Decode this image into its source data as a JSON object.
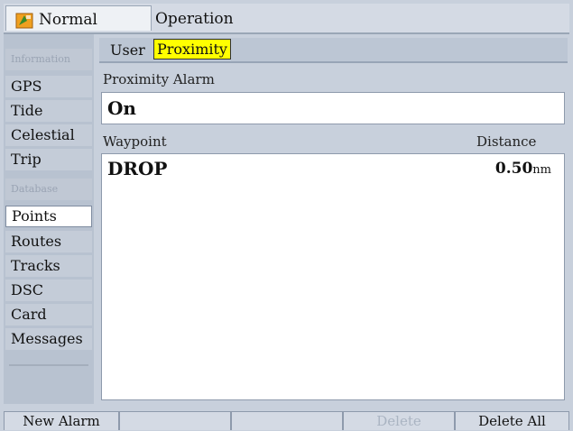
{
  "titlebar": {
    "app_name": "Normal",
    "page_title": "Operation",
    "icon": "vessel-flag-icon"
  },
  "sidebar": {
    "items": [
      {
        "label": "Information",
        "state": "disabled"
      },
      {
        "label": "GPS",
        "state": "normal"
      },
      {
        "label": "Tide",
        "state": "normal"
      },
      {
        "label": "Celestial",
        "state": "normal"
      },
      {
        "label": "Trip",
        "state": "normal"
      },
      {
        "label": "Database",
        "state": "disabled"
      },
      {
        "label": "Points",
        "state": "selected"
      },
      {
        "label": "Routes",
        "state": "normal"
      },
      {
        "label": "Tracks",
        "state": "normal"
      },
      {
        "label": "DSC",
        "state": "normal"
      },
      {
        "label": "Card",
        "state": "normal"
      },
      {
        "label": "Messages",
        "state": "normal"
      }
    ]
  },
  "subtabs": {
    "user": "User",
    "proximity": "Proximity"
  },
  "proximity_alarm": {
    "label": "Proximity Alarm",
    "value": "On"
  },
  "table": {
    "col_waypoint": "Waypoint",
    "col_distance": "Distance",
    "rows": [
      {
        "waypoint": "DROP",
        "distance": "0.50",
        "unit": "nm"
      }
    ]
  },
  "softkeys": {
    "new_alarm": "New Alarm",
    "key2": "",
    "key3": "",
    "delete": "Delete",
    "delete_all": "Delete All"
  },
  "colors": {
    "highlight": "#ffff00",
    "background": "#c8d0dc"
  }
}
